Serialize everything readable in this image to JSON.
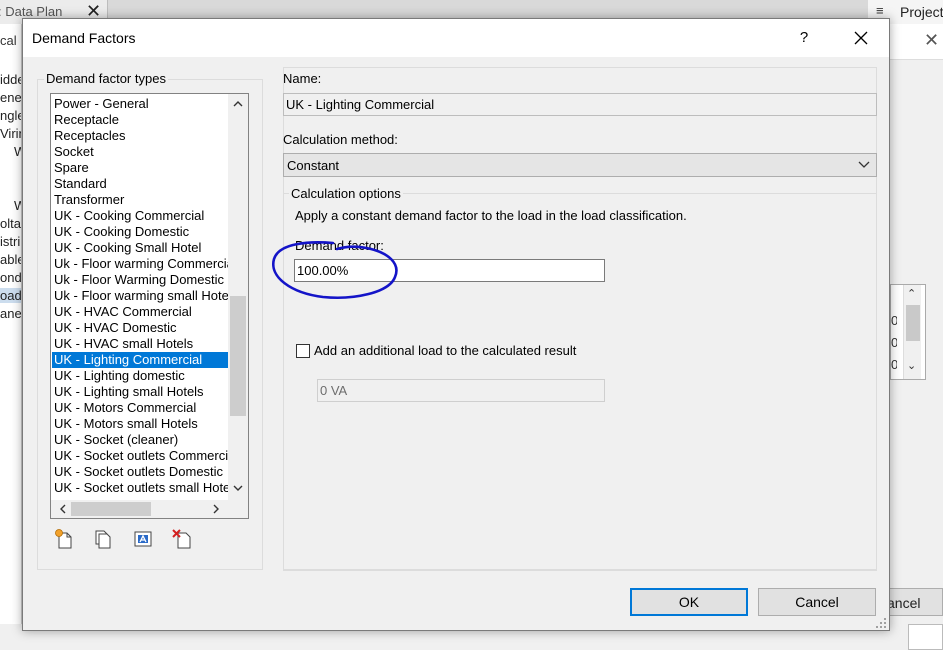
{
  "background": {
    "tab_title": ": Data Plan",
    "tab_close": "✕",
    "project_label": "Project",
    "menu_glyph": "≡",
    "left_header": "cal",
    "left_items": [
      "idde",
      "ene",
      "ngle",
      "Virin",
      "W",
      "W",
      "olta",
      "istri",
      "able",
      "ond",
      "oad",
      "ane"
    ],
    "grid_cells": [
      "0",
      "0",
      "0"
    ],
    "cancel_label": "ancel",
    "close_glyph": "✕"
  },
  "dialog": {
    "title": "Demand Factors",
    "help_label": "?",
    "types_group_label": "Demand factor types",
    "types": [
      "Power - General",
      "Receptacle",
      "Receptacles",
      "Socket",
      "Spare",
      "Standard",
      "Transformer",
      "UK - Cooking Commercial",
      "UK - Cooking Domestic",
      "UK - Cooking Small Hotel",
      "Uk - Floor warming Commercial",
      "Uk - Floor Warming Domestic",
      "Uk - Floor warming small Hotels",
      "UK - HVAC Commercial",
      "UK - HVAC Domestic",
      "UK - HVAC small Hotels",
      "UK - Lighting Commercial",
      "UK - Lighting domestic",
      "UK - Lighting small Hotels",
      "UK - Motors Commercial",
      "UK - Motors small Hotels",
      "UK - Socket (cleaner)",
      "UK - Socket outlets Commercial",
      "UK - Socket outlets Domestic",
      "UK - Socket outlets small Hotels"
    ],
    "name_label": "Name:",
    "name_value": "UK - Lighting Commercial",
    "method_label": "Calculation method:",
    "method_value": "Constant",
    "options_group_label": "Calculation options",
    "options_description": "Apply a constant demand factor to the load in the load classification.",
    "demand_factor_label": "Demand factor:",
    "demand_factor_value": "100.00%",
    "additional_load_label": "Add an additional load to the calculated result",
    "additional_load_checked": false,
    "additional_load_value": "0 VA",
    "ok_label": "OK",
    "cancel_label": "Cancel"
  },
  "colors": {
    "selection": "#0078d7",
    "annotation": "#1414c8",
    "dialog_bg": "#f0f0f0"
  },
  "icons": [
    "new-type-icon",
    "duplicate-type-icon",
    "rename-type-icon",
    "delete-type-icon"
  ]
}
